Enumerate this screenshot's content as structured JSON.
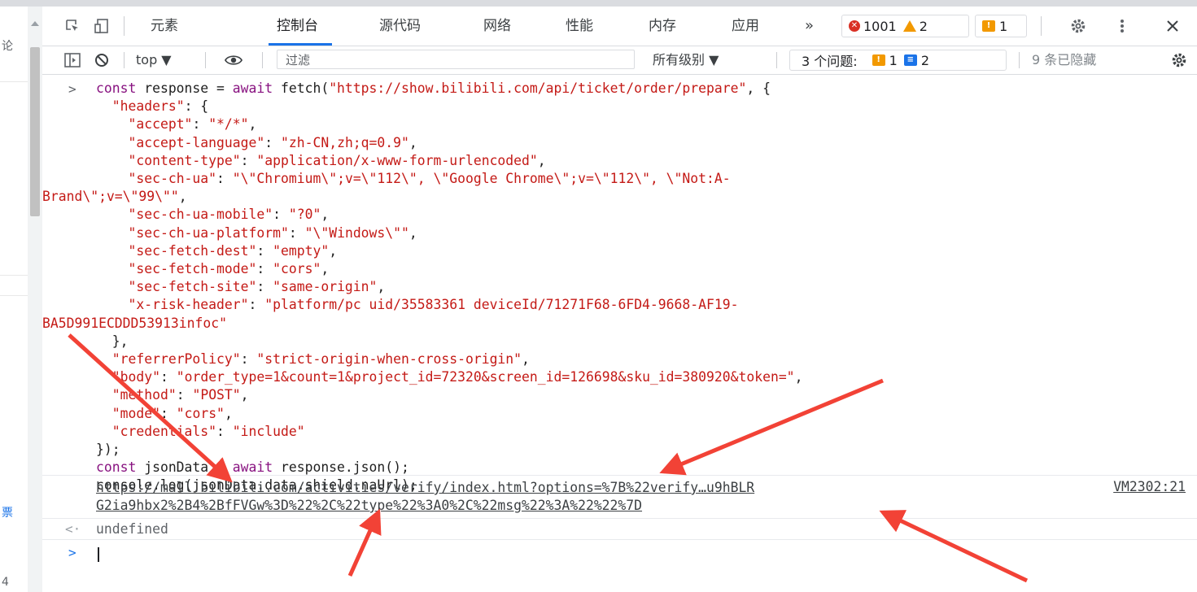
{
  "tabs": {
    "items": [
      "元素",
      "控制台",
      "源代码",
      "网络",
      "性能",
      "内存",
      "应用"
    ],
    "more": "»",
    "errors": "1001",
    "warnings": "2",
    "issues": "1"
  },
  "filter": {
    "context": "top ▼",
    "placeholder": "过滤",
    "levels": "所有级别 ▼",
    "problems_label": "3 个问题:",
    "problems_orange": "1",
    "problems_blue": "2",
    "hidden": "9 条已隐藏"
  },
  "left_pane": {
    "frag1": "论",
    "frag2": "票",
    "frag3": "4"
  },
  "console": {
    "input_prompt": ">",
    "output": {
      "link_line1": "https://mall.bilibili.com/activities/verify/index.html?options=%7B%22verify…u9hBLR",
      "link_line2": "G2ia9hbx2%2B4%2BfFVGw%3D%22%2C%22type%22%3A0%2C%22msg%22%3A%22%22%7D",
      "source": "VM2302:21"
    },
    "return_arrow": "<·",
    "return_value": "undefined",
    "next_prompt": ">"
  },
  "colors": {
    "accent": "#1a73e8",
    "error": "#d93025",
    "warning": "#f29900",
    "annotation_arrow": "#f24236"
  }
}
